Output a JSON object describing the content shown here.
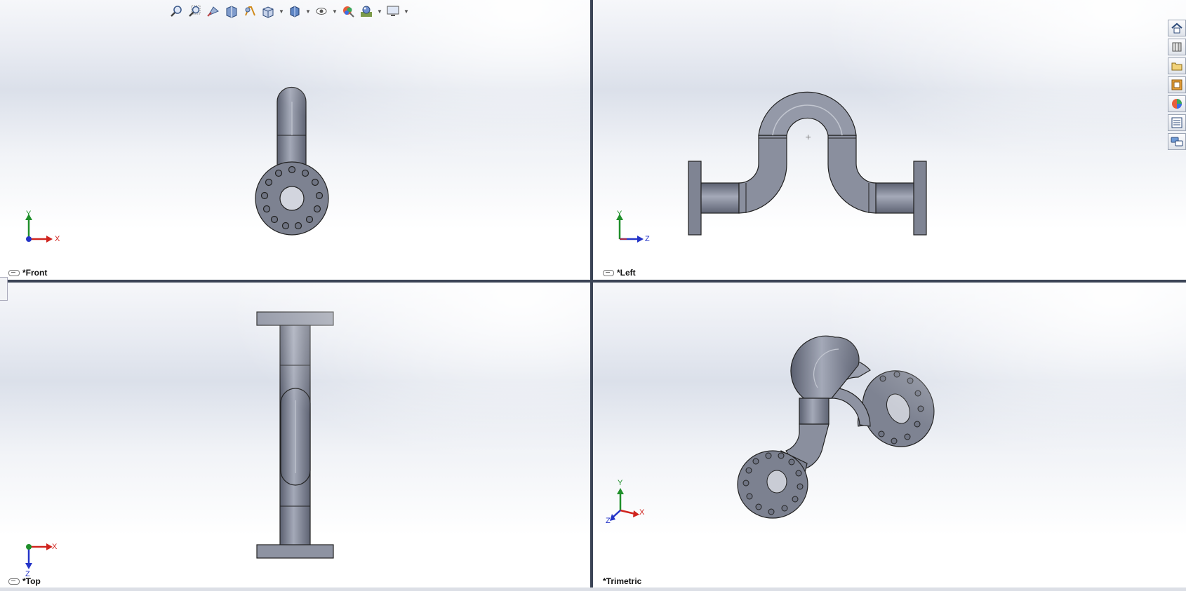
{
  "viewports": [
    {
      "view": "*Front",
      "triad": [
        "X",
        "Y",
        ""
      ]
    },
    {
      "view": "*Left",
      "triad": [
        "Z",
        "Y",
        ""
      ]
    },
    {
      "view": "*Top",
      "triad": [
        "X",
        "",
        "Z"
      ]
    },
    {
      "view": "*Trimetric",
      "triad": [
        "X",
        "Y",
        "Z"
      ]
    }
  ],
  "toolbar": {
    "icons": [
      "zoom-to-fit-icon",
      "zoom-to-area-icon",
      "previous-view-icon",
      "section-view-icon",
      "dynamic-annotation-icon",
      "view-orientation-icon",
      "display-style-icon",
      "hide-show-items-icon",
      "edit-appearance-icon",
      "apply-scene-icon",
      "view-settings-icon"
    ]
  },
  "taskpane": {
    "icons": [
      "home-icon",
      "design-library-icon",
      "file-explorer-icon",
      "view-palette-icon",
      "appearances-icon",
      "custom-properties-icon",
      "forum-icon"
    ]
  },
  "colors": {
    "part": "#8a8f9e",
    "part_dark": "#4d5160",
    "axis_x": "#d0241e",
    "axis_y": "#1f8f2a",
    "axis_z": "#2434c8",
    "divider": "#3b4456"
  }
}
